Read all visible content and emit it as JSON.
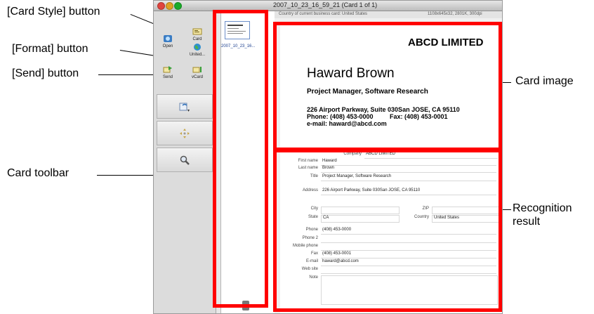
{
  "callouts": {
    "card_style": "[Card Style] button",
    "format": "[Format] button",
    "send": "[Send] button",
    "card_toolbar": "Card toolbar",
    "card_image": "Card image",
    "recognition_result_line1": "Recognition",
    "recognition_result_line2": "result"
  },
  "window": {
    "title": "2007_10_23_16_59_21 (Card 1 of 1)",
    "info_left": "Country of current business card: United States",
    "info_right": "1108x645x32, 2801K, 300dpi"
  },
  "toolbar": {
    "open": "Open",
    "card": "Card",
    "united": "United...",
    "send": "Send",
    "vcard": "vCard",
    "icons": [
      "open-icon",
      "card-style-icon",
      "globe-icon",
      "send-icon",
      "vcard-icon",
      "rotate-icon",
      "move-icon",
      "zoom-icon"
    ]
  },
  "thumbnail": {
    "label": "2007_10_23_16..."
  },
  "card": {
    "company": "ABCD LIMITED",
    "name": "Haward Brown",
    "title": "Project Manager, Software Research",
    "address": "226 Airport Parkway, Suite 030San JOSE, CA 95110",
    "phone": "Phone: (408) 453-0000",
    "fax": "Fax: (408) 453-0001",
    "email": "e-mail: haward@abcd.com"
  },
  "form": {
    "company_label": "Company",
    "company_value": "ABCD LIMITED",
    "first_label": "First name",
    "first_value": "Haward",
    "last_label": "Last name",
    "last_value": "Brown",
    "title_label": "Title",
    "title_value": "Project Manager, Software Research",
    "address_label": "Address",
    "address_value": "226 Airport Parkway, Suite 030San JOSE, CA 95110",
    "city_label": "City",
    "city_value": "",
    "zip_label": "ZIP",
    "zip_value": "",
    "state_label": "State",
    "state_value": "CA",
    "country_label": "Country",
    "country_value": "United States",
    "phone_label": "Phone",
    "phone_value": "(408) 453-0000",
    "phone2_label": "Phone 2",
    "phone2_value": "",
    "mobile_label": "Mobile phone",
    "mobile_value": "",
    "fax_label": "Fax",
    "fax_value": "(408) 453-0001",
    "email_label": "E-mail",
    "email_value": "haward@abcd.com",
    "web_label": "Web site",
    "web_value": "",
    "note_label": "Note",
    "note_value": ""
  },
  "colors": {
    "highlight": "#ff0000",
    "traffic_red": "#e0443e",
    "traffic_yellow": "#dea123",
    "traffic_green": "#1aab29"
  }
}
